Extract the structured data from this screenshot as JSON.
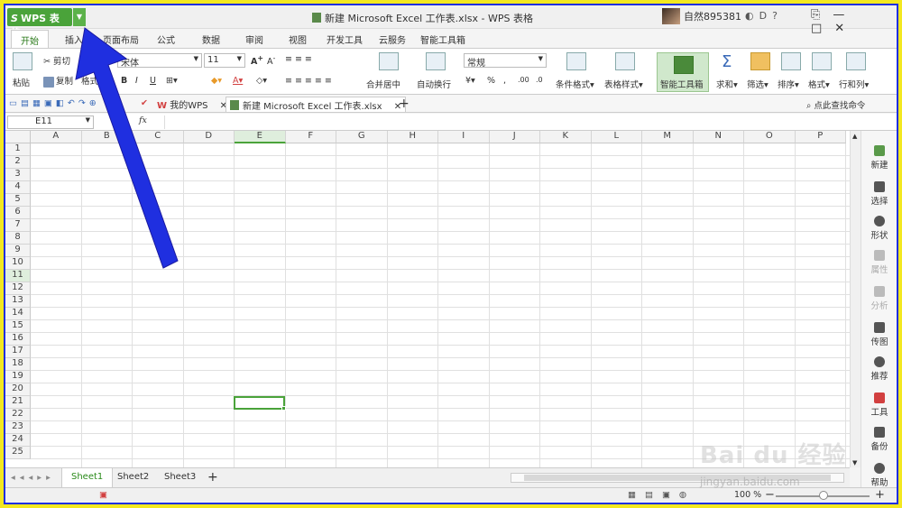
{
  "app": {
    "menu_label": "WPS 表格",
    "window_title": "新建 Microsoft Excel 工作表.xlsx - WPS 表格",
    "username": "自然895381",
    "window_controls": [
      "minimize-icon",
      "maximize-icon",
      "close-icon"
    ]
  },
  "ribbon_tabs": [
    "开始",
    "插入",
    "页面布局",
    "公式",
    "数据",
    "审阅",
    "视图",
    "开发工具",
    "云服务",
    "智能工具箱"
  ],
  "ribbon": {
    "paste": "粘贴",
    "cut": "剪切",
    "copy": "复制",
    "format_painter": "格式刷",
    "font_name": "宋体",
    "font_size": "11",
    "merge_center": "合并居中",
    "wrap_text": "自动换行",
    "number_format": "常规",
    "percent": "%",
    "conditional_format": "条件格式",
    "table_style": "表格样式",
    "smart_toolbox": "智能工具箱",
    "sum": "求和",
    "filter": "筛选",
    "sort": "排序",
    "format": "格式",
    "row_col": "行和列"
  },
  "quickbar": {
    "tab_mywps": "我的WPS",
    "tab_doc": "新建 Microsoft Excel 工作表.xlsx",
    "search_cmd": "点此查找命令"
  },
  "formula_bar": {
    "name_box": "E11",
    "fx": "fx",
    "content": ""
  },
  "columns": [
    "A",
    "B",
    "C",
    "D",
    "E",
    "F",
    "G",
    "H",
    "I",
    "J",
    "K",
    "L",
    "M",
    "N",
    "O",
    "P"
  ],
  "rows": [
    "1",
    "2",
    "3",
    "4",
    "5",
    "6",
    "7",
    "8",
    "9",
    "10",
    "11",
    "12",
    "13",
    "14",
    "15",
    "16",
    "17",
    "18",
    "19",
    "20",
    "21",
    "22",
    "23",
    "24",
    "25"
  ],
  "selected_cell": {
    "column": "E",
    "row": "11"
  },
  "side_panel": [
    {
      "label": "新建",
      "enabled": true
    },
    {
      "label": "选择",
      "enabled": true
    },
    {
      "label": "形状",
      "enabled": true
    },
    {
      "label": "属性",
      "enabled": false
    },
    {
      "label": "分析",
      "enabled": false
    },
    {
      "label": "传图",
      "enabled": true
    },
    {
      "label": "推荐",
      "enabled": true
    },
    {
      "label": "工具",
      "enabled": true
    },
    {
      "label": "备份",
      "enabled": true
    },
    {
      "label": "帮助",
      "enabled": true
    }
  ],
  "sheets": [
    "Sheet1",
    "Sheet2",
    "Sheet3"
  ],
  "active_sheet": "Sheet1",
  "status": {
    "zoom": "100 %"
  },
  "watermark": {
    "logo": "Bai du 经验",
    "url": "jingyan.baidu.com"
  },
  "colors": {
    "accent": "#4aa33a",
    "arrow": "#1f2fe0",
    "frame": "#f3e820"
  }
}
